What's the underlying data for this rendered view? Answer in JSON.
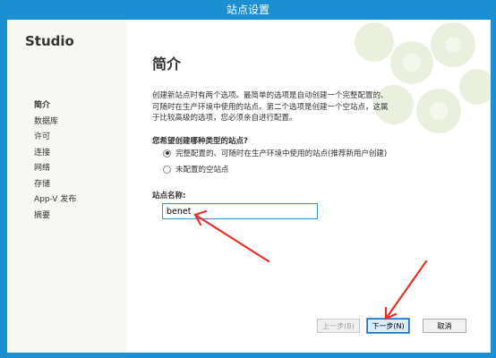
{
  "window": {
    "title": "站点设置"
  },
  "sidebar": {
    "brand": "Studio",
    "items": [
      {
        "label": "简介"
      },
      {
        "label": "数据库"
      },
      {
        "label": "许可"
      },
      {
        "label": "连接"
      },
      {
        "label": "网络"
      },
      {
        "label": "存储"
      },
      {
        "label": "App-V 发布"
      },
      {
        "label": "摘要"
      }
    ]
  },
  "main": {
    "heading": "简介",
    "description": "创建新站点时有两个选项。最简单的选项是自动创建一个完整配置的、可随时在生产环境中使用的站点。第二个选项是创建一个空站点，这属于比较高级的选项，您必须亲自进行配置。",
    "question": "您希望创建哪种类型的站点?",
    "options": [
      {
        "label": "完整配置的、可随时在生产环境中使用的站点(推荐新用户创建)",
        "checked": true
      },
      {
        "label": "未配置的空站点",
        "checked": false
      }
    ],
    "site_name_label": "站点名称:",
    "site_name_value": "benet"
  },
  "footer": {
    "back_label": "上一步(B)",
    "next_label": "下一步(N)",
    "cancel_label": "取消"
  },
  "colors": {
    "frame": "#1c8fd3",
    "arrow": "#e8302a",
    "accent": "#3c8fd6"
  }
}
